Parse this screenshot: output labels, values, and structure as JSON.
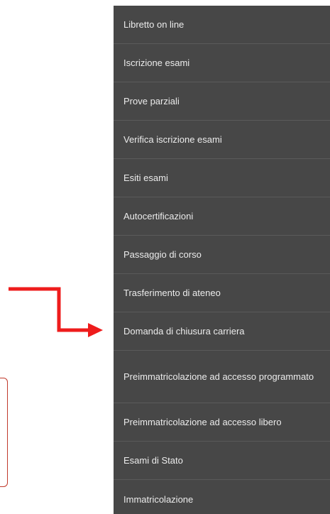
{
  "menu": {
    "items": [
      {
        "label": "Libretto on line"
      },
      {
        "label": "Iscrizione esami"
      },
      {
        "label": "Prove parziali"
      },
      {
        "label": "Verifica iscrizione esami"
      },
      {
        "label": "Esiti esami"
      },
      {
        "label": "Autocertificazioni"
      },
      {
        "label": "Passaggio di corso"
      },
      {
        "label": "Trasferimento di ateneo"
      },
      {
        "label": "Domanda di chiusura carriera"
      },
      {
        "label": "Preimmatricolazione ad accesso programmato"
      },
      {
        "label": "Preimmatricolazione ad accesso libero"
      },
      {
        "label": "Esami di Stato"
      },
      {
        "label": "Immatricolazione"
      }
    ]
  },
  "annotation": {
    "arrow_color": "#ee1c1c",
    "box_border_color": "#c0392b"
  },
  "colors": {
    "menu_background": "#474747",
    "menu_text": "#ececec",
    "divider": "#5a5a5a"
  }
}
